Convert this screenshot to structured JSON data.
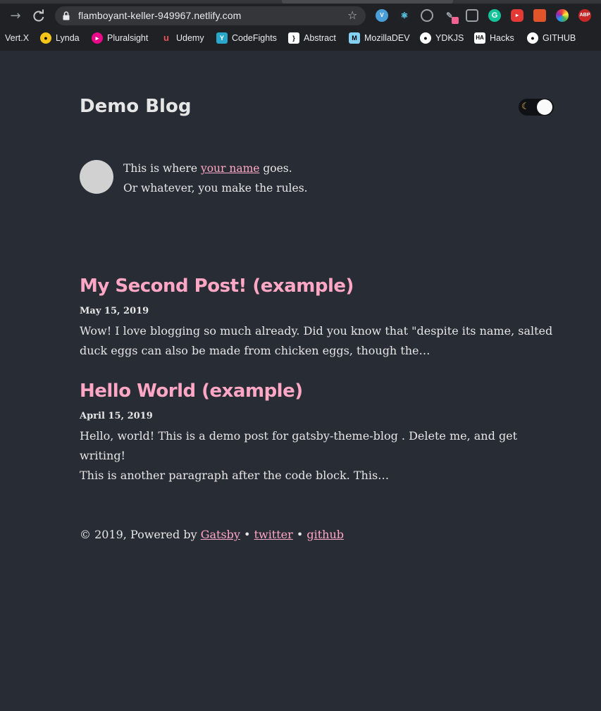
{
  "browser": {
    "url": "flamboyant-keller-949967.netlify.com",
    "bookmarks": [
      {
        "label": "Vert.X",
        "icon": "vertx-icon",
        "color": "#202124"
      },
      {
        "label": "Lynda",
        "icon": "lynda-icon",
        "color": "#f5c518"
      },
      {
        "label": "Pluralsight",
        "icon": "pluralsight-icon",
        "color": "#e80a89"
      },
      {
        "label": "Udemy",
        "icon": "udemy-icon",
        "color": "#ec5252"
      },
      {
        "label": "CodeFights",
        "icon": "codefights-icon",
        "color": "#2ba6cb"
      },
      {
        "label": "Abstract",
        "icon": "abstract-icon",
        "color": "#ffffff"
      },
      {
        "label": "MozillaDEV",
        "icon": "mozilla-icon",
        "color": "#83d0f2"
      },
      {
        "label": "YDKJS",
        "icon": "github-icon",
        "color": "#ffffff"
      },
      {
        "label": "Hacks",
        "icon": "hacks-icon",
        "color": "#ffffff"
      },
      {
        "label": "GITHUB",
        "icon": "github-icon",
        "color": "#ffffff"
      }
    ]
  },
  "site": {
    "title": "Demo Blog",
    "theme_toggle_icon": "moon-icon"
  },
  "bio": {
    "line1_prefix": "This is where ",
    "line1_link": "your name",
    "line1_suffix": " goes.",
    "line2": "Or whatever, you make the rules."
  },
  "posts": [
    {
      "title": "My Second Post! (example)",
      "date": "May 15, 2019",
      "excerpt_line1": "Wow! I love blogging so much already. Did you know that \"despite its name, salted",
      "excerpt_line2": "duck eggs can also be made from chicken eggs, though the…"
    },
    {
      "title": "Hello World (example)",
      "date": "April 15, 2019",
      "excerpt_line1": "Hello, world! This is a demo post for gatsby-theme-blog . Delete me, and get writing!",
      "excerpt_line2": "This is another paragraph after the code block. This…"
    }
  ],
  "footer": {
    "prefix": "© 2019, Powered by ",
    "gatsby": "Gatsby",
    "sep1": " • ",
    "twitter": "twitter",
    "sep2": " • ",
    "github": "github"
  },
  "colors": {
    "background": "#282c35",
    "accent": "#ffa7c4",
    "text": "#e6e6e6"
  }
}
